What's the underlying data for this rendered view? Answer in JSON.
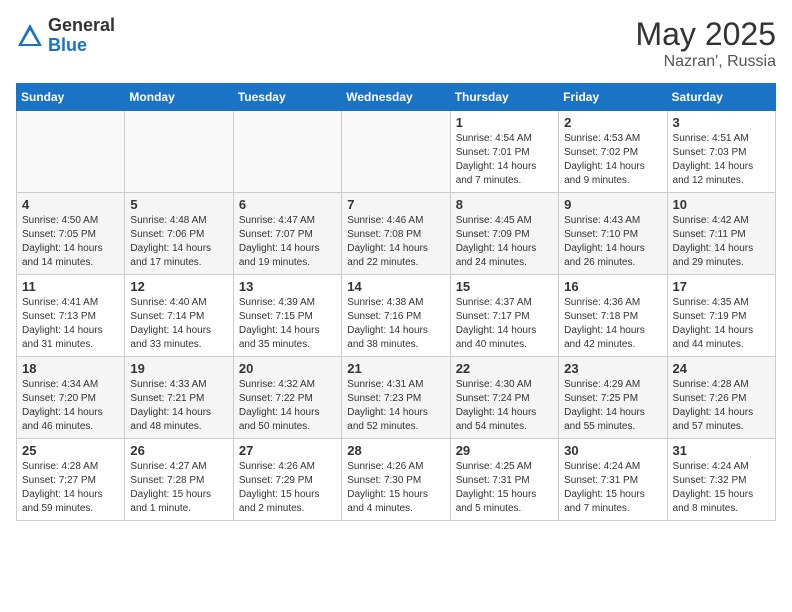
{
  "header": {
    "logo_general": "General",
    "logo_blue": "Blue",
    "month": "May 2025",
    "location": "Nazran', Russia"
  },
  "days_of_week": [
    "Sunday",
    "Monday",
    "Tuesday",
    "Wednesday",
    "Thursday",
    "Friday",
    "Saturday"
  ],
  "weeks": [
    [
      {
        "day": "",
        "info": ""
      },
      {
        "day": "",
        "info": ""
      },
      {
        "day": "",
        "info": ""
      },
      {
        "day": "",
        "info": ""
      },
      {
        "day": "1",
        "info": "Sunrise: 4:54 AM\nSunset: 7:01 PM\nDaylight: 14 hours\nand 7 minutes."
      },
      {
        "day": "2",
        "info": "Sunrise: 4:53 AM\nSunset: 7:02 PM\nDaylight: 14 hours\nand 9 minutes."
      },
      {
        "day": "3",
        "info": "Sunrise: 4:51 AM\nSunset: 7:03 PM\nDaylight: 14 hours\nand 12 minutes."
      }
    ],
    [
      {
        "day": "4",
        "info": "Sunrise: 4:50 AM\nSunset: 7:05 PM\nDaylight: 14 hours\nand 14 minutes."
      },
      {
        "day": "5",
        "info": "Sunrise: 4:48 AM\nSunset: 7:06 PM\nDaylight: 14 hours\nand 17 minutes."
      },
      {
        "day": "6",
        "info": "Sunrise: 4:47 AM\nSunset: 7:07 PM\nDaylight: 14 hours\nand 19 minutes."
      },
      {
        "day": "7",
        "info": "Sunrise: 4:46 AM\nSunset: 7:08 PM\nDaylight: 14 hours\nand 22 minutes."
      },
      {
        "day": "8",
        "info": "Sunrise: 4:45 AM\nSunset: 7:09 PM\nDaylight: 14 hours\nand 24 minutes."
      },
      {
        "day": "9",
        "info": "Sunrise: 4:43 AM\nSunset: 7:10 PM\nDaylight: 14 hours\nand 26 minutes."
      },
      {
        "day": "10",
        "info": "Sunrise: 4:42 AM\nSunset: 7:11 PM\nDaylight: 14 hours\nand 29 minutes."
      }
    ],
    [
      {
        "day": "11",
        "info": "Sunrise: 4:41 AM\nSunset: 7:13 PM\nDaylight: 14 hours\nand 31 minutes."
      },
      {
        "day": "12",
        "info": "Sunrise: 4:40 AM\nSunset: 7:14 PM\nDaylight: 14 hours\nand 33 minutes."
      },
      {
        "day": "13",
        "info": "Sunrise: 4:39 AM\nSunset: 7:15 PM\nDaylight: 14 hours\nand 35 minutes."
      },
      {
        "day": "14",
        "info": "Sunrise: 4:38 AM\nSunset: 7:16 PM\nDaylight: 14 hours\nand 38 minutes."
      },
      {
        "day": "15",
        "info": "Sunrise: 4:37 AM\nSunset: 7:17 PM\nDaylight: 14 hours\nand 40 minutes."
      },
      {
        "day": "16",
        "info": "Sunrise: 4:36 AM\nSunset: 7:18 PM\nDaylight: 14 hours\nand 42 minutes."
      },
      {
        "day": "17",
        "info": "Sunrise: 4:35 AM\nSunset: 7:19 PM\nDaylight: 14 hours\nand 44 minutes."
      }
    ],
    [
      {
        "day": "18",
        "info": "Sunrise: 4:34 AM\nSunset: 7:20 PM\nDaylight: 14 hours\nand 46 minutes."
      },
      {
        "day": "19",
        "info": "Sunrise: 4:33 AM\nSunset: 7:21 PM\nDaylight: 14 hours\nand 48 minutes."
      },
      {
        "day": "20",
        "info": "Sunrise: 4:32 AM\nSunset: 7:22 PM\nDaylight: 14 hours\nand 50 minutes."
      },
      {
        "day": "21",
        "info": "Sunrise: 4:31 AM\nSunset: 7:23 PM\nDaylight: 14 hours\nand 52 minutes."
      },
      {
        "day": "22",
        "info": "Sunrise: 4:30 AM\nSunset: 7:24 PM\nDaylight: 14 hours\nand 54 minutes."
      },
      {
        "day": "23",
        "info": "Sunrise: 4:29 AM\nSunset: 7:25 PM\nDaylight: 14 hours\nand 55 minutes."
      },
      {
        "day": "24",
        "info": "Sunrise: 4:28 AM\nSunset: 7:26 PM\nDaylight: 14 hours\nand 57 minutes."
      }
    ],
    [
      {
        "day": "25",
        "info": "Sunrise: 4:28 AM\nSunset: 7:27 PM\nDaylight: 14 hours\nand 59 minutes."
      },
      {
        "day": "26",
        "info": "Sunrise: 4:27 AM\nSunset: 7:28 PM\nDaylight: 15 hours\nand 1 minute."
      },
      {
        "day": "27",
        "info": "Sunrise: 4:26 AM\nSunset: 7:29 PM\nDaylight: 15 hours\nand 2 minutes."
      },
      {
        "day": "28",
        "info": "Sunrise: 4:26 AM\nSunset: 7:30 PM\nDaylight: 15 hours\nand 4 minutes."
      },
      {
        "day": "29",
        "info": "Sunrise: 4:25 AM\nSunset: 7:31 PM\nDaylight: 15 hours\nand 5 minutes."
      },
      {
        "day": "30",
        "info": "Sunrise: 4:24 AM\nSunset: 7:31 PM\nDaylight: 15 hours\nand 7 minutes."
      },
      {
        "day": "31",
        "info": "Sunrise: 4:24 AM\nSunset: 7:32 PM\nDaylight: 15 hours\nand 8 minutes."
      }
    ]
  ]
}
